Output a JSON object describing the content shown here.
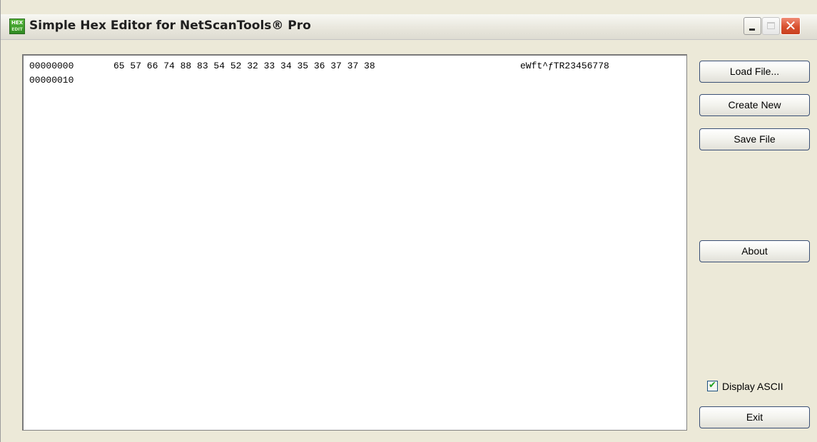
{
  "window": {
    "title": "Simple Hex Editor for NetScanTools® Pro",
    "icon": "hex-edit-icon",
    "icon_text": "HEX",
    "icon_subtext": "EDIT",
    "controls": {
      "minimize": "minimize-icon",
      "maximize": "maximize-icon",
      "close": "close-icon",
      "close_glyph": "✕"
    }
  },
  "hex_view": {
    "rows": [
      {
        "offset": "00000000",
        "bytes": "65 57 66 74 88 83 54 52 32 33 34 35 36 37 37 38",
        "ascii": "eWft^ƒTR23456778"
      },
      {
        "offset": "00000010",
        "bytes": "",
        "ascii": ""
      }
    ]
  },
  "buttons": {
    "load_file": "Load File...",
    "create_new": "Create New",
    "save_file": "Save File",
    "about": "About",
    "exit": "Exit"
  },
  "options": {
    "display_ascii_label": "Display ASCII",
    "display_ascii_checked": true,
    "check_glyph": "✔"
  },
  "colors": {
    "window_bg": "#ece9d8",
    "close_button": "#d8502f",
    "checkmark": "#21a121",
    "button_border": "#3a4f75"
  }
}
